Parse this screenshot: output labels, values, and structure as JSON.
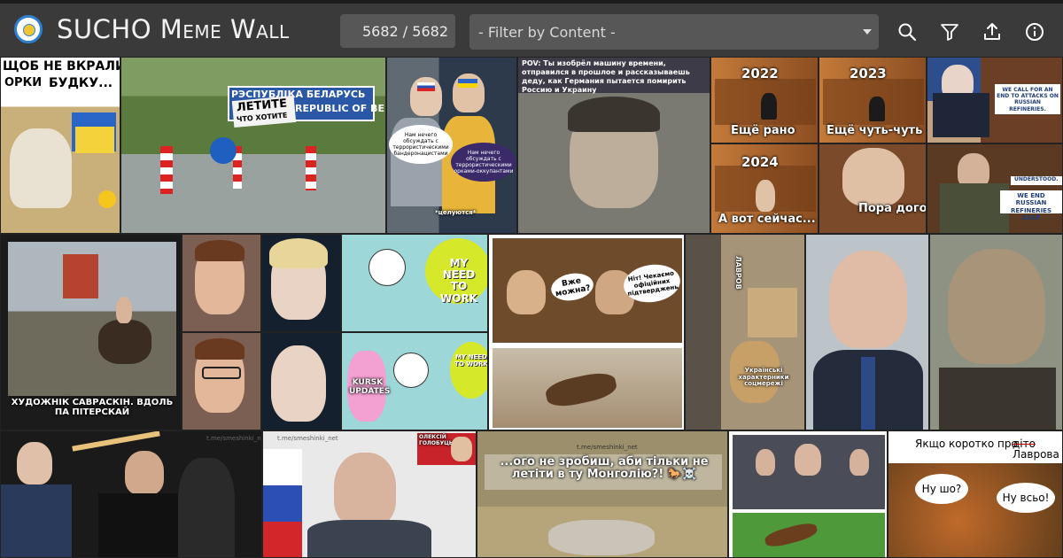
{
  "app": {
    "title": "SUCHO Meme Wall",
    "counter": "5682 / 5682",
    "filter_placeholder": "- Filter by Content -"
  },
  "toolbar": {
    "icons": [
      "search-icon",
      "filter-icon",
      "upload-icon",
      "info-icon"
    ]
  },
  "colors": {
    "topbar": "#3a3a3a",
    "field": "#575757",
    "background": "#2b2b2b"
  },
  "memes": {
    "dog": {
      "line1": "ЩОБ НЕ ВКРАЛИ",
      "line2_a": "ОРКИ",
      "line2_b": "БУДКУ..."
    },
    "border": {
      "sign1": "РЭСПУБЛІКА БЕЛАРУСЬ",
      "sign2": "REPUBLIC OF BELARUS",
      "plate1": "ЛЕТИТЕ",
      "plate2": "ЧТО ХОТИТЕ"
    },
    "teens": {
      "bubble1": "Нам нечего обсуждать с террористическими бандеронацистами",
      "bubble2": "Нам нечего обсуждать с террористическими орками-оккупантами",
      "caption": "*целуются*"
    },
    "time_machine": {
      "caption": "POV: Ты изобрёл машину времени, отправился в прошлое и рассказываешь деду, как Германия пытается помирить Россию и Украину"
    },
    "years": {
      "y1": "2022",
      "t1": "Ещё рано",
      "y2": "2023",
      "t2": "Ещё чуть-чуть",
      "y3": "2024",
      "t3": "А вот сейчас...",
      "t4": "Пора договариваться"
    },
    "phone": {
      "top": "WE CALL FOR AN END TO ATTACKS ON RUSSIAN REFINERIES.",
      "bottom_small": "UNDERSTOOD.",
      "bottom": "WE END RUSSIAN REFINERIES ASAP"
    },
    "painting": {
      "caption": "ХУДОЖНІК САВРАСКІН. ВДОЛЬ ПА ПІТЕРСКАЙ"
    },
    "work": {
      "label1": "MY NEED TO WORK",
      "label2": "MY NEED TO WORK",
      "label3": "KURSK UPDATES"
    },
    "tavern": {
      "bubble1": "Вже можна?",
      "bubble2": "Ніт! Чекаємо офіційних підтверджень"
    },
    "lavrov_cat": {
      "label": "ЛАВРОВ",
      "caption": "Українські характерники соцмережі"
    },
    "lavrov_reaper": {
      "watermark": "t.me/smeshinki_net"
    },
    "lavrov_flag": {
      "watermark": "t.me/smeshinki_net",
      "badge": "ОЛЕКСІЙ ГОЛОБУЦЬКИЙ"
    },
    "mongolia": {
      "caption": "...ого не зробиш, аби тільки не летіти в ту Монголію?! 🐎☠️",
      "watermark": "t.me/smeshinki_net"
    },
    "short": {
      "header": "Якщо коротко про",
      "strike": "діто",
      "name": "Лаврова",
      "b1": "Ну шо?",
      "b2": "Ну всьо!"
    }
  }
}
